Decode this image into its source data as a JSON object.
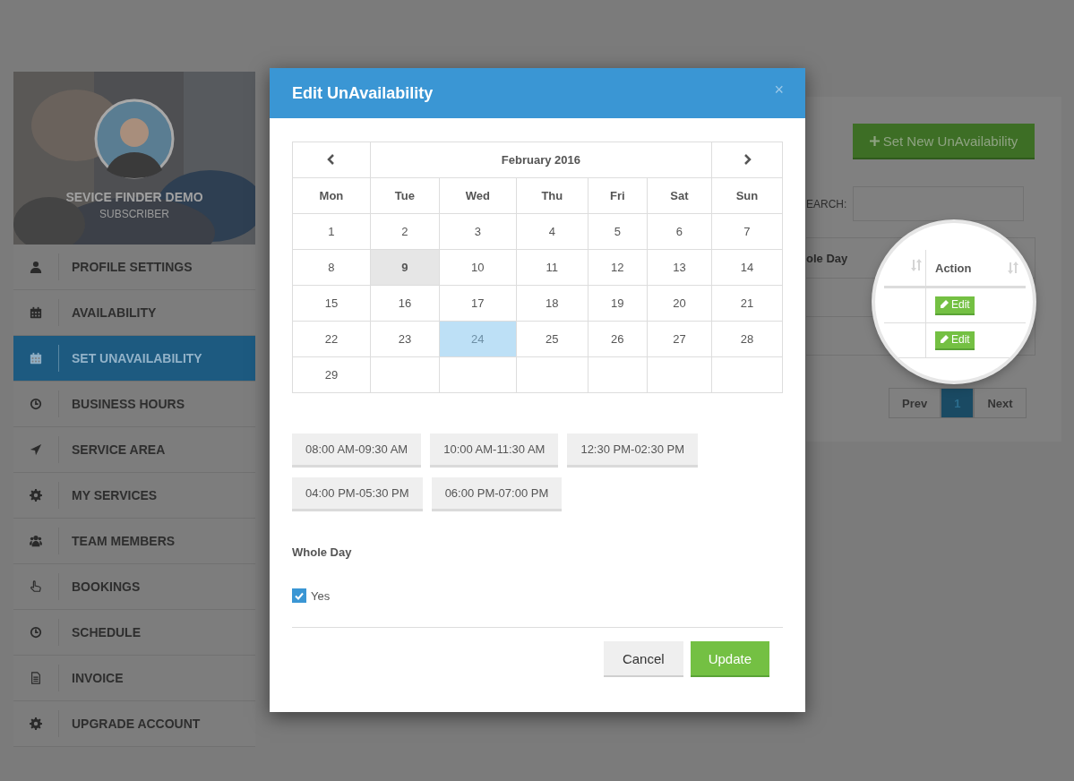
{
  "sidebar": {
    "profile": {
      "name": "SEVICE FINDER DEMO",
      "role": "SUBSCRIBER"
    },
    "items": [
      {
        "label": "PROFILE SETTINGS",
        "selected": false
      },
      {
        "label": "AVAILABILITY",
        "selected": false
      },
      {
        "label": "SET UNAVAILABILITY",
        "selected": true
      },
      {
        "label": "BUSINESS HOURS",
        "selected": false
      },
      {
        "label": "SERVICE AREA",
        "selected": false
      },
      {
        "label": "MY SERVICES",
        "selected": false
      },
      {
        "label": "TEAM MEMBERS",
        "selected": false
      },
      {
        "label": "BOOKINGS",
        "selected": false
      },
      {
        "label": "SCHEDULE",
        "selected": false
      },
      {
        "label": "INVOICE",
        "selected": false
      },
      {
        "label": "UPGRADE ACCOUNT",
        "selected": false
      }
    ]
  },
  "panel": {
    "new_button": "Set New UnAvailability",
    "search_label": "EARCH:",
    "table_header": "ole Day",
    "pagination": [
      {
        "label": "Prev",
        "selected": false
      },
      {
        "label": "1",
        "selected": true
      },
      {
        "label": "Next",
        "selected": false
      }
    ],
    "magnifier": {
      "column": "Action",
      "rows": [
        {
          "button": "Edit"
        },
        {
          "button": "Edit"
        }
      ]
    }
  },
  "modal": {
    "title": "Edit UnAvailability",
    "close": "×",
    "calendar": {
      "month": "February 2016",
      "weekdays": [
        "Mon",
        "Tue",
        "Wed",
        "Thu",
        "Fri",
        "Sat",
        "Sun"
      ],
      "weeks": [
        [
          {
            "day": "1",
            "today": false,
            "selected": false
          },
          {
            "day": "2",
            "today": false,
            "selected": false
          },
          {
            "day": "3",
            "today": false,
            "selected": false
          },
          {
            "day": "4",
            "today": false,
            "selected": false
          },
          {
            "day": "5",
            "today": false,
            "selected": false
          },
          {
            "day": "6",
            "today": false,
            "selected": false
          },
          {
            "day": "7",
            "today": false,
            "selected": false
          }
        ],
        [
          {
            "day": "8",
            "today": false,
            "selected": false
          },
          {
            "day": "9",
            "today": true,
            "selected": false
          },
          {
            "day": "10",
            "today": false,
            "selected": false
          },
          {
            "day": "11",
            "today": false,
            "selected": false
          },
          {
            "day": "12",
            "today": false,
            "selected": false
          },
          {
            "day": "13",
            "today": false,
            "selected": false
          },
          {
            "day": "14",
            "today": false,
            "selected": false
          }
        ],
        [
          {
            "day": "15",
            "today": false,
            "selected": false
          },
          {
            "day": "16",
            "today": false,
            "selected": false
          },
          {
            "day": "17",
            "today": false,
            "selected": false
          },
          {
            "day": "18",
            "today": false,
            "selected": false
          },
          {
            "day": "19",
            "today": false,
            "selected": false
          },
          {
            "day": "20",
            "today": false,
            "selected": false
          },
          {
            "day": "21",
            "today": false,
            "selected": false
          }
        ],
        [
          {
            "day": "22",
            "today": false,
            "selected": false
          },
          {
            "day": "23",
            "today": false,
            "selected": false
          },
          {
            "day": "24",
            "today": false,
            "selected": true
          },
          {
            "day": "25",
            "today": false,
            "selected": false
          },
          {
            "day": "26",
            "today": false,
            "selected": false
          },
          {
            "day": "27",
            "today": false,
            "selected": false
          },
          {
            "day": "28",
            "today": false,
            "selected": false
          }
        ],
        [
          {
            "day": "29",
            "today": false,
            "selected": false
          }
        ]
      ]
    },
    "time_slots": [
      "08:00 AM-09:30 AM",
      "10:00 AM-11:30 AM",
      "12:30 PM-02:30 PM",
      "04:00 PM-05:30 PM",
      "06:00 PM-07:00 PM"
    ],
    "whole_day": {
      "label": "Whole Day",
      "option": "Yes",
      "checked": true
    },
    "buttons": [
      {
        "label": "Cancel",
        "kind": "secondary"
      },
      {
        "label": "Update",
        "kind": "primary"
      }
    ]
  }
}
